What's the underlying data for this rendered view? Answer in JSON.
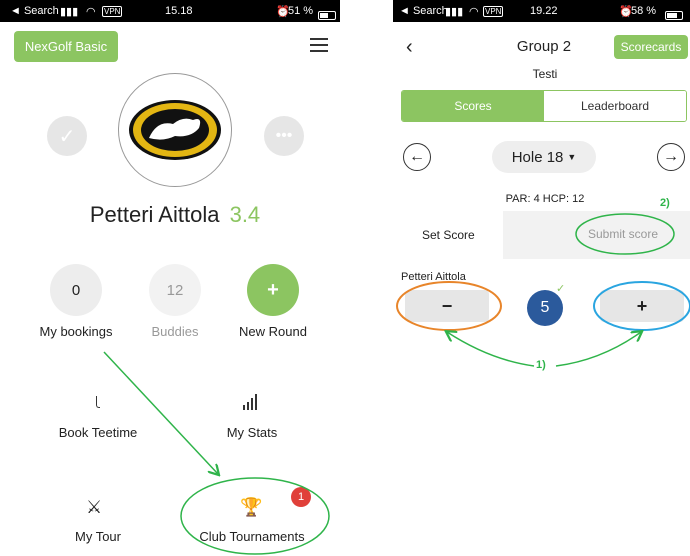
{
  "left": {
    "status": {
      "carrier": "◄ Search",
      "vpn": "VPN",
      "time": "15.18",
      "battery": "51 %"
    },
    "brand_label": "NexGolf Basic",
    "user_name": "Petteri Aittola",
    "handicap": "3.4",
    "stats": [
      {
        "value": "0",
        "label": "My bookings"
      },
      {
        "value": "12",
        "label": "Buddies"
      },
      {
        "value": "+",
        "label": "New Round"
      }
    ],
    "menu": [
      {
        "label": "Book Teetime"
      },
      {
        "label": "My Stats"
      },
      {
        "label": "My Tour"
      },
      {
        "label": "Club Tournaments",
        "badge": "1"
      }
    ]
  },
  "right": {
    "status": {
      "carrier": "◄ Search",
      "vpn": "VPN",
      "time": "19.22",
      "battery": "58 %"
    },
    "group_title": "Group 2",
    "scorecards_label": "Scorecards",
    "subtitle": "Testi",
    "tabs": [
      {
        "label": "Scores",
        "active": true
      },
      {
        "label": "Leaderboard",
        "active": false
      }
    ],
    "hole_label": "Hole 18",
    "par_info": "PAR: 4 HCP: 12",
    "set_score_label": "Set Score",
    "submit_label": "Submit score",
    "player_name": "Petteri Aittola",
    "minus_label": "−",
    "plus_label": "+",
    "score_value": "5"
  },
  "annotations": {
    "step1": "1)",
    "step2": "2)"
  },
  "colors": {
    "accent": "#8cc561",
    "score_blue": "#2b5a9c",
    "orange": "#e8852a",
    "cyan": "#2aa5e0",
    "badge_red": "#e0403a"
  }
}
